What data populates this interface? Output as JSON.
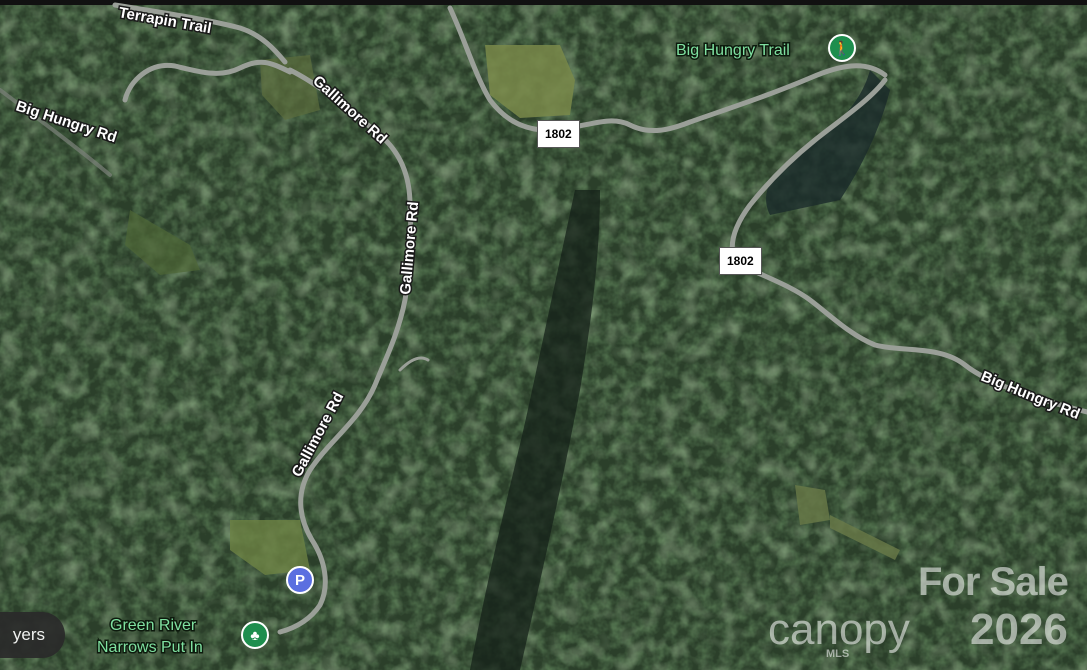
{
  "roads": {
    "terrapin_trail": "Terrapin Trail",
    "big_hungry_rd_left": "Big Hungry Rd",
    "big_hungry_rd_right": "Big Hungry Rd",
    "gallimore_rd_top": "Gallimore Rd",
    "gallimore_rd_mid": "Gallimore Rd",
    "gallimore_rd_bottom": "Gallimore Rd",
    "route_shield_top": "1802",
    "route_shield_mid": "1802"
  },
  "places": {
    "big_hungry_trail": "Big Hungry Trail",
    "green_river_line1": "Green River",
    "green_river_line2": "Narrows Put In"
  },
  "controls": {
    "layers": "yers",
    "parking": "P"
  },
  "watermark": {
    "for_sale": "For Sale",
    "brand": "canopy",
    "brand_sub": "MLS",
    "year": "2026"
  },
  "icons": {
    "trail_pin": "hiker-icon",
    "put_in_pin": "tree-icon",
    "parking_pin": "parking-icon"
  },
  "colors": {
    "forest": "#2b3f2a",
    "road": "#8a8f88",
    "poi_label": "#7fe0a0",
    "parking_pin": "#5b6fe0",
    "poi_pin": "#1e8e4e"
  }
}
